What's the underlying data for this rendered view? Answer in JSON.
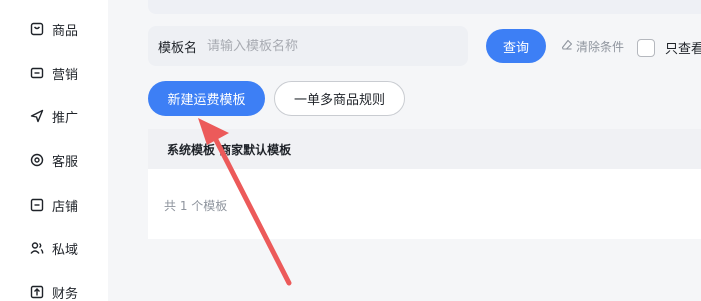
{
  "sidebar": {
    "items": [
      {
        "label": "商品",
        "icon": "product-icon"
      },
      {
        "label": "营销",
        "icon": "marketing-icon"
      },
      {
        "label": "推广",
        "icon": "promotion-icon"
      },
      {
        "label": "客服",
        "icon": "customer-service-icon"
      },
      {
        "label": "店铺",
        "icon": "shop-icon"
      },
      {
        "label": "私域",
        "icon": "private-domain-icon"
      },
      {
        "label": "财务",
        "icon": "finance-icon"
      }
    ]
  },
  "filter": {
    "label": "模板名",
    "placeholder": "请输入模板名称",
    "query_label": "查询",
    "clear_label": "清除条件",
    "checkbox_label": "只查看"
  },
  "actions": {
    "new_template_label": "新建运费模板",
    "rule_label": "一单多商品规则"
  },
  "table": {
    "header": "系统模板 商家默认模板",
    "count_text": "共 1 个模板"
  },
  "colors": {
    "accent": "#3d7ff5",
    "annotation_arrow": "#ec5a5a"
  }
}
